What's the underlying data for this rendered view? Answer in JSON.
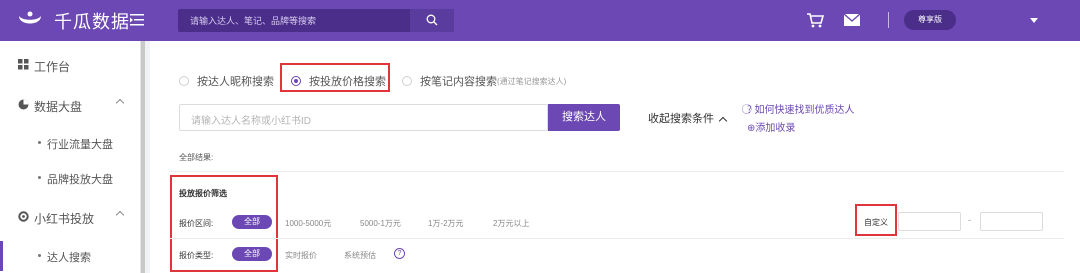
{
  "header": {
    "app_name": "千瓜数据",
    "search_placeholder": "请输入达人、笔记、品牌等搜索",
    "plan_label": "尊享版",
    "icons": [
      "logo-icon",
      "menu-toggle-icon",
      "search-icon",
      "cart-icon",
      "mail-icon",
      "chevron-down-icon"
    ],
    "accent_color": "#6b48b3"
  },
  "sidebar": {
    "items": [
      {
        "label": "工作台",
        "icon": "grid-icon"
      },
      {
        "label": "数据大盘",
        "icon": "pie-chart-icon"
      },
      {
        "label": "行业流量大盘"
      },
      {
        "label": "品牌投放大盘"
      },
      {
        "label": "小红书投放",
        "icon": "settings-icon"
      },
      {
        "label": "达人搜索"
      }
    ]
  },
  "main": {
    "search_modes": [
      {
        "label": "按达人昵称搜索",
        "hint": "",
        "selected": false
      },
      {
        "label": "按投放价格搜索",
        "hint": "",
        "selected": true
      },
      {
        "label": "按笔记内容搜索",
        "hint": "(通过笔记搜索达人)",
        "selected": false
      }
    ],
    "keyword_placeholder": "请输入达人名称或小红书ID",
    "search_button": "搜索达人",
    "collapse_label": "收起搜索条件",
    "help_link": "如何快速找到优质达人",
    "add_link": "添加收录",
    "all_results_label": "全部结果:",
    "filter_title": "投放报价筛选",
    "price_range": {
      "label": "报价区间:",
      "selected": "全部",
      "options": [
        "1000-5000元",
        "5000-1万元",
        "1万-2万元",
        "2万元以上"
      ]
    },
    "price_type": {
      "label": "报价类型:",
      "selected": "全部",
      "options": [
        "实时报价",
        "系统预估"
      ]
    },
    "custom_label": "自定义",
    "range_separator": "-",
    "highlight_color": "#e0363b"
  }
}
